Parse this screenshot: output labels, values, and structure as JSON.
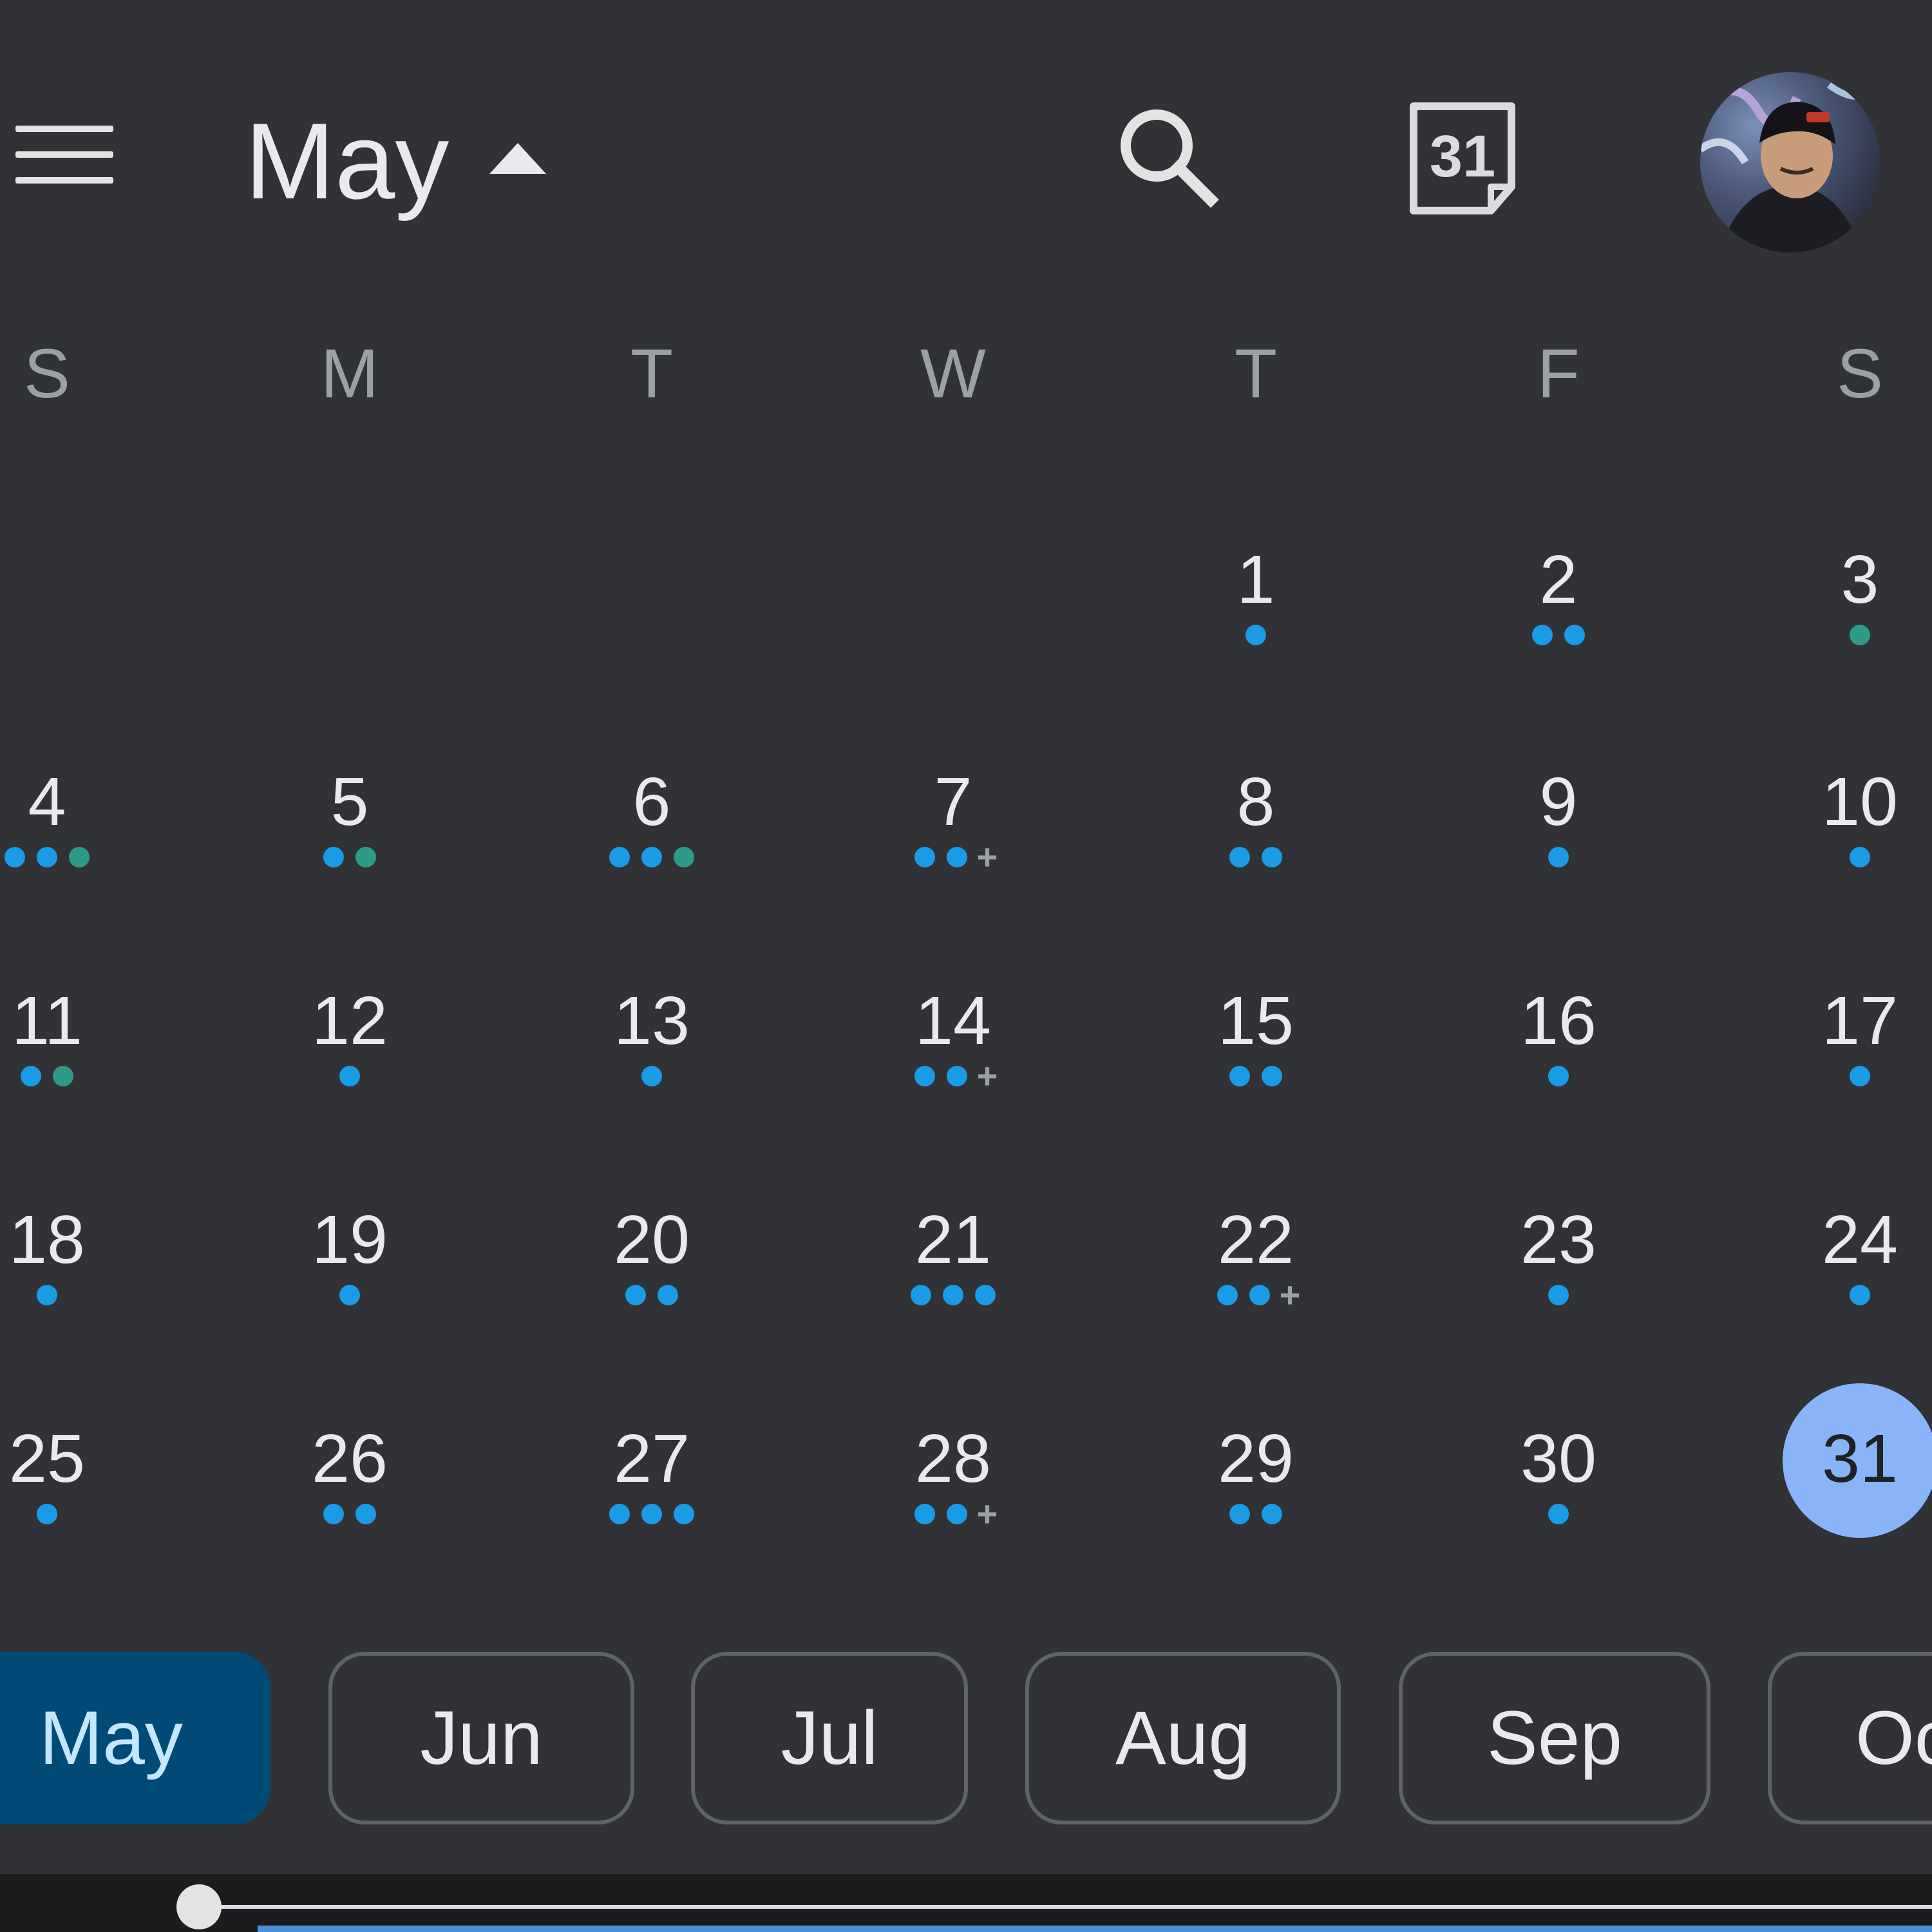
{
  "header": {
    "month_title": "May",
    "today_icon_number": "31"
  },
  "weekdays": [
    "S",
    "M",
    "T",
    "W",
    "T",
    "F",
    "S"
  ],
  "calendar": {
    "today": 31,
    "days": [
      {
        "d": "1",
        "dots": [
          "blue"
        ],
        "more": false
      },
      {
        "d": "2",
        "dots": [
          "blue",
          "blue"
        ],
        "more": false
      },
      {
        "d": "3",
        "dots": [
          "teal"
        ],
        "more": false
      },
      {
        "d": "4",
        "dots": [
          "blue",
          "blue",
          "teal"
        ],
        "more": false
      },
      {
        "d": "5",
        "dots": [
          "blue",
          "teal"
        ],
        "more": false
      },
      {
        "d": "6",
        "dots": [
          "blue",
          "blue",
          "teal"
        ],
        "more": false
      },
      {
        "d": "7",
        "dots": [
          "blue",
          "blue"
        ],
        "more": true
      },
      {
        "d": "8",
        "dots": [
          "blue",
          "blue"
        ],
        "more": false
      },
      {
        "d": "9",
        "dots": [
          "blue"
        ],
        "more": false
      },
      {
        "d": "10",
        "dots": [
          "blue"
        ],
        "more": false
      },
      {
        "d": "11",
        "dots": [
          "blue",
          "teal"
        ],
        "more": false
      },
      {
        "d": "12",
        "dots": [
          "blue"
        ],
        "more": false
      },
      {
        "d": "13",
        "dots": [
          "blue"
        ],
        "more": false
      },
      {
        "d": "14",
        "dots": [
          "blue",
          "blue"
        ],
        "more": true
      },
      {
        "d": "15",
        "dots": [
          "blue",
          "blue"
        ],
        "more": false
      },
      {
        "d": "16",
        "dots": [
          "blue"
        ],
        "more": false
      },
      {
        "d": "17",
        "dots": [
          "blue"
        ],
        "more": false
      },
      {
        "d": "18",
        "dots": [
          "blue"
        ],
        "more": false
      },
      {
        "d": "19",
        "dots": [
          "blue"
        ],
        "more": false
      },
      {
        "d": "20",
        "dots": [
          "blue",
          "blue"
        ],
        "more": false
      },
      {
        "d": "21",
        "dots": [
          "blue",
          "blue",
          "blue"
        ],
        "more": false
      },
      {
        "d": "22",
        "dots": [
          "blue",
          "blue"
        ],
        "more": true
      },
      {
        "d": "23",
        "dots": [
          "blue"
        ],
        "more": false
      },
      {
        "d": "24",
        "dots": [
          "blue"
        ],
        "more": false
      },
      {
        "d": "25",
        "dots": [
          "blue"
        ],
        "more": false
      },
      {
        "d": "26",
        "dots": [
          "blue",
          "blue"
        ],
        "more": false
      },
      {
        "d": "27",
        "dots": [
          "blue",
          "blue",
          "blue"
        ],
        "more": false
      },
      {
        "d": "28",
        "dots": [
          "blue",
          "blue"
        ],
        "more": true
      },
      {
        "d": "29",
        "dots": [
          "blue",
          "blue"
        ],
        "more": false
      },
      {
        "d": "30",
        "dots": [
          "blue"
        ],
        "more": false
      },
      {
        "d": "31",
        "dots": [],
        "more": false
      }
    ],
    "more_symbol": "+"
  },
  "month_chips": [
    {
      "label": "May",
      "active": true
    },
    {
      "label": "Jun",
      "active": false
    },
    {
      "label": "Jul",
      "active": false
    },
    {
      "label": "Aug",
      "active": false
    },
    {
      "label": "Sep",
      "active": false
    },
    {
      "label": "Oc",
      "active": false
    }
  ],
  "colors": {
    "background": "#313236",
    "event_blue": "#1a9be6",
    "event_teal": "#2e9a8a",
    "today_highlight": "#8ab4f8",
    "active_chip": "#004a77"
  },
  "icons": [
    "menu-icon",
    "caret-up-icon",
    "search-icon",
    "today-calendar-icon",
    "avatar"
  ]
}
